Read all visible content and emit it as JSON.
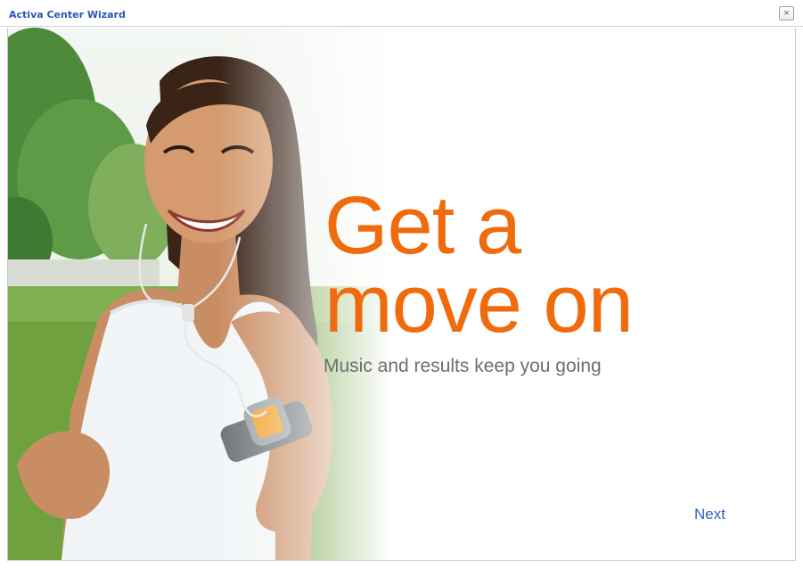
{
  "window": {
    "title": "Activa Center Wizard",
    "close_label": "×"
  },
  "hero": {
    "headline_line1": "Get a",
    "headline_line2": "move on",
    "subline": "Music and results keep you going"
  },
  "navigation": {
    "next_label": "Next"
  },
  "icons": {
    "close": "close-icon"
  },
  "colors": {
    "accent": "#f06b0e",
    "title": "#2b55b8",
    "link": "#2f5fbf",
    "subline": "#6e6e6e"
  }
}
